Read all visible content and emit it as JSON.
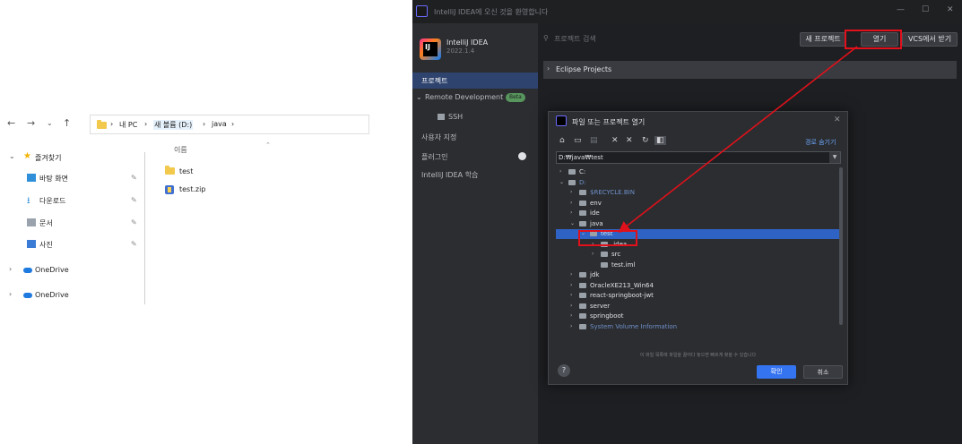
{
  "explorer": {
    "nav": {
      "back": "←",
      "forward": "→",
      "recent": "⌄",
      "up": "↑"
    },
    "breadcrumb": [
      "내 PC",
      "새 볼륨 (D:)",
      "java"
    ],
    "sidebar": [
      {
        "label": "즐겨찾기",
        "expanded": true
      },
      {
        "label": "바탕 화면",
        "pinned": true
      },
      {
        "label": "다운로드",
        "pinned": true
      },
      {
        "label": "문서",
        "pinned": true
      },
      {
        "label": "사진",
        "pinned": true
      },
      {
        "label": "OneDrive"
      },
      {
        "label": "OneDrive"
      }
    ],
    "column_header": "이름",
    "files": [
      {
        "name": "test",
        "type": "folder"
      },
      {
        "name": "test.zip",
        "type": "zip"
      }
    ]
  },
  "intellij": {
    "window_title": "IntelliJ IDEA에 오신 것을 환영합니다",
    "brand_name": "IntelliJ IDEA",
    "brand_version": "2022.1.4",
    "brand_logo_text": "IJ",
    "nav": [
      {
        "label": "프로젝트",
        "active": true
      },
      {
        "label": "Remote Development",
        "badge": "Beta"
      },
      {
        "label": "SSH"
      },
      {
        "label": "사용자 지정"
      },
      {
        "label": "플러그인",
        "dot": true
      },
      {
        "label": "IntelliJ IDEA 학습"
      }
    ],
    "search_placeholder": "프로젝트 검색",
    "buttons": {
      "new_project": "새 프로젝트",
      "open": "열기",
      "vcs": "VCS에서 받기"
    },
    "eclipse_group": "Eclipse Projects"
  },
  "dialog": {
    "title": "파일 또는 프로젝트 열기",
    "hide_path": "경로 숨기기",
    "path": "D:₩java₩test",
    "tree": [
      {
        "label": "C:",
        "depth": 0,
        "arrow": ">"
      },
      {
        "label": "D:",
        "depth": 0,
        "arrow": "v",
        "dim": true
      },
      {
        "label": "$RECYCLE.BIN",
        "depth": 1,
        "arrow": ">",
        "dim": true
      },
      {
        "label": "env",
        "depth": 1,
        "arrow": ">"
      },
      {
        "label": "ide",
        "depth": 1,
        "arrow": ">"
      },
      {
        "label": "java",
        "depth": 1,
        "arrow": "v"
      },
      {
        "label": "test",
        "depth": 2,
        "arrow": "v",
        "selected": true
      },
      {
        "label": ".idea",
        "depth": 3,
        "arrow": ">"
      },
      {
        "label": "src",
        "depth": 3,
        "arrow": ">"
      },
      {
        "label": "test.iml",
        "depth": 3,
        "arrow": ""
      },
      {
        "label": "jdk",
        "depth": 1,
        "arrow": ">"
      },
      {
        "label": "OracleXE213_Win64",
        "depth": 1,
        "arrow": ">"
      },
      {
        "label": "react-springboot-jwt",
        "depth": 1,
        "arrow": ">"
      },
      {
        "label": "server",
        "depth": 1,
        "arrow": ">"
      },
      {
        "label": "springboot",
        "depth": 1,
        "arrow": ">"
      },
      {
        "label": "System Volume Information",
        "depth": 1,
        "arrow": ">",
        "dim": true
      }
    ],
    "hint": "이 파일 목록에 파일을 끌어다 놓으면 빠르게 찾을 수 있습니다",
    "help": "?",
    "ok": "확인",
    "cancel": "취소",
    "tools": [
      "⌂",
      "▭",
      "▤",
      "✕",
      "↻",
      "◧"
    ]
  },
  "annotation": {
    "color": "#e0111b"
  }
}
